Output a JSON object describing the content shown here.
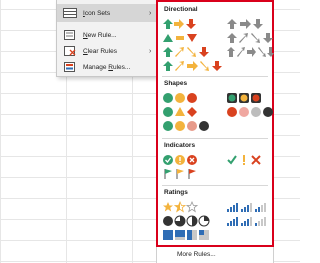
{
  "menu": {
    "items": [
      {
        "label": "Icon Sets",
        "underline": "I",
        "rest": "con Sets",
        "has_submenu": true,
        "active": true
      },
      {
        "label": "New Rule...",
        "underline": "N",
        "rest": "ew Rule...",
        "has_submenu": false,
        "active": false
      },
      {
        "label": "Clear Rules",
        "underline": "C",
        "rest": "lear Rules",
        "has_submenu": true,
        "active": false
      },
      {
        "label": "Manage Rules...",
        "underline": "R",
        "prefix": "Manage ",
        "rest": "ules...",
        "has_submenu": false,
        "active": false
      }
    ]
  },
  "icon_sets": {
    "sections": [
      {
        "title": "Directional"
      },
      {
        "title": "Shapes"
      },
      {
        "title": "Indicators"
      },
      {
        "title": "Ratings"
      }
    ],
    "more_rules": "More Rules..."
  },
  "colors": {
    "green": "#33a06f",
    "yellow": "#f3b33d",
    "red": "#d9421f",
    "gray": "#8a8a8a",
    "blue": "#2f6db5",
    "highlight_border": "#d9001b"
  }
}
